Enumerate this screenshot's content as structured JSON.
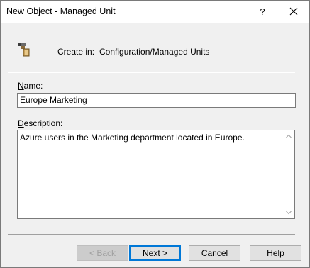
{
  "window": {
    "title": "New Object - Managed Unit",
    "help_label": "?"
  },
  "header": {
    "icon": "tool-icon",
    "create_in_label": "Create in:",
    "create_in_path": "Configuration/Managed Units"
  },
  "form": {
    "name_label_underlined": "N",
    "name_label_rest": "ame:",
    "name_value": "Europe Marketing",
    "description_label_underlined": "D",
    "description_label_rest": "escription:",
    "description_value": "Azure users in the Marketing department located in Europe."
  },
  "buttons": {
    "back_prefix": "< ",
    "back_underlined": "B",
    "back_rest": "ack",
    "next_underlined": "N",
    "next_rest": "ext >",
    "cancel": "Cancel",
    "help": "Help"
  }
}
